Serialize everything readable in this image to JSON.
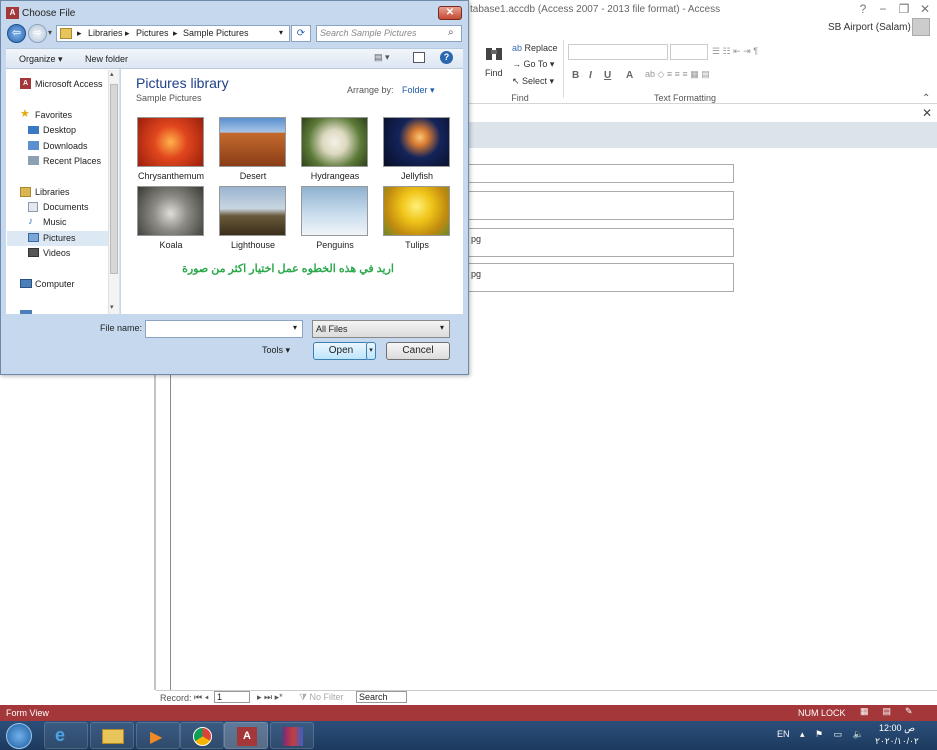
{
  "access": {
    "title": "tabase1.accdb (Access 2007 - 2013 file format) - Access",
    "account": "SB Airport (Salam)",
    "win_controls": [
      "?",
      "−",
      "❐",
      "✕"
    ],
    "ribbon": {
      "find_group": {
        "find": "Find",
        "replace": "Replace",
        "goto": "Go To ▾",
        "select": "Select ▾",
        "label": "Find"
      },
      "text_formatting_label": "Text Formatting",
      "format_buttons": [
        "B",
        "I",
        "U",
        "A"
      ]
    },
    "fields": [
      "",
      "",
      "pg",
      "pg"
    ],
    "record_nav": {
      "label": "Record:",
      "current": "1",
      "no_filter": "No Filter",
      "search": "Search"
    },
    "status": {
      "view": "Form View",
      "numlock": "NUM LOCK"
    }
  },
  "taskbar": {
    "apps": [
      "start",
      "internet-explorer",
      "file-explorer",
      "media-player",
      "chrome",
      "access",
      "winrar"
    ],
    "lang": "EN",
    "time": "ص 12:00",
    "date": "٢٠٢٠/١٠/٠٢"
  },
  "dialog": {
    "title": "Choose File",
    "breadcrumb": [
      "Libraries",
      "Pictures",
      "Sample Pictures"
    ],
    "search_placeholder": "Search Sample Pictures",
    "toolbar": {
      "organize": "Organize ▾",
      "new_folder": "New folder"
    },
    "tree": {
      "microsoft_access": "Microsoft Access",
      "favorites": "Favorites",
      "favorites_items": [
        "Desktop",
        "Downloads",
        "Recent Places"
      ],
      "libraries": "Libraries",
      "libraries_items": [
        "Documents",
        "Music",
        "Pictures",
        "Videos"
      ],
      "computer": "Computer"
    },
    "library": {
      "title": "Pictures library",
      "subtitle": "Sample Pictures",
      "arrange_by": "Arrange by:",
      "arrange_value": "Folder ▾"
    },
    "images": [
      {
        "name": "Chrysanthemum",
        "color": "#d8361a"
      },
      {
        "name": "Desert",
        "color": "#b5602a"
      },
      {
        "name": "Hydrangeas",
        "color": "#6c8a3e"
      },
      {
        "name": "Jellyfish",
        "color": "#1c2f63"
      },
      {
        "name": "Koala",
        "color": "#8d8c85"
      },
      {
        "name": "Lighthouse",
        "color": "#6f86a2"
      },
      {
        "name": "Penguins",
        "color": "#8eb1cf"
      },
      {
        "name": "Tulips",
        "color": "#e1b316"
      }
    ],
    "arabic_note": "اريد في هذه الخطوه عمل اختيار اكثر من صورة",
    "file_name_label": "File name:",
    "file_name_value": "",
    "file_type": "All Files",
    "tools": "Tools ▾",
    "open": "Open",
    "cancel": "Cancel"
  }
}
